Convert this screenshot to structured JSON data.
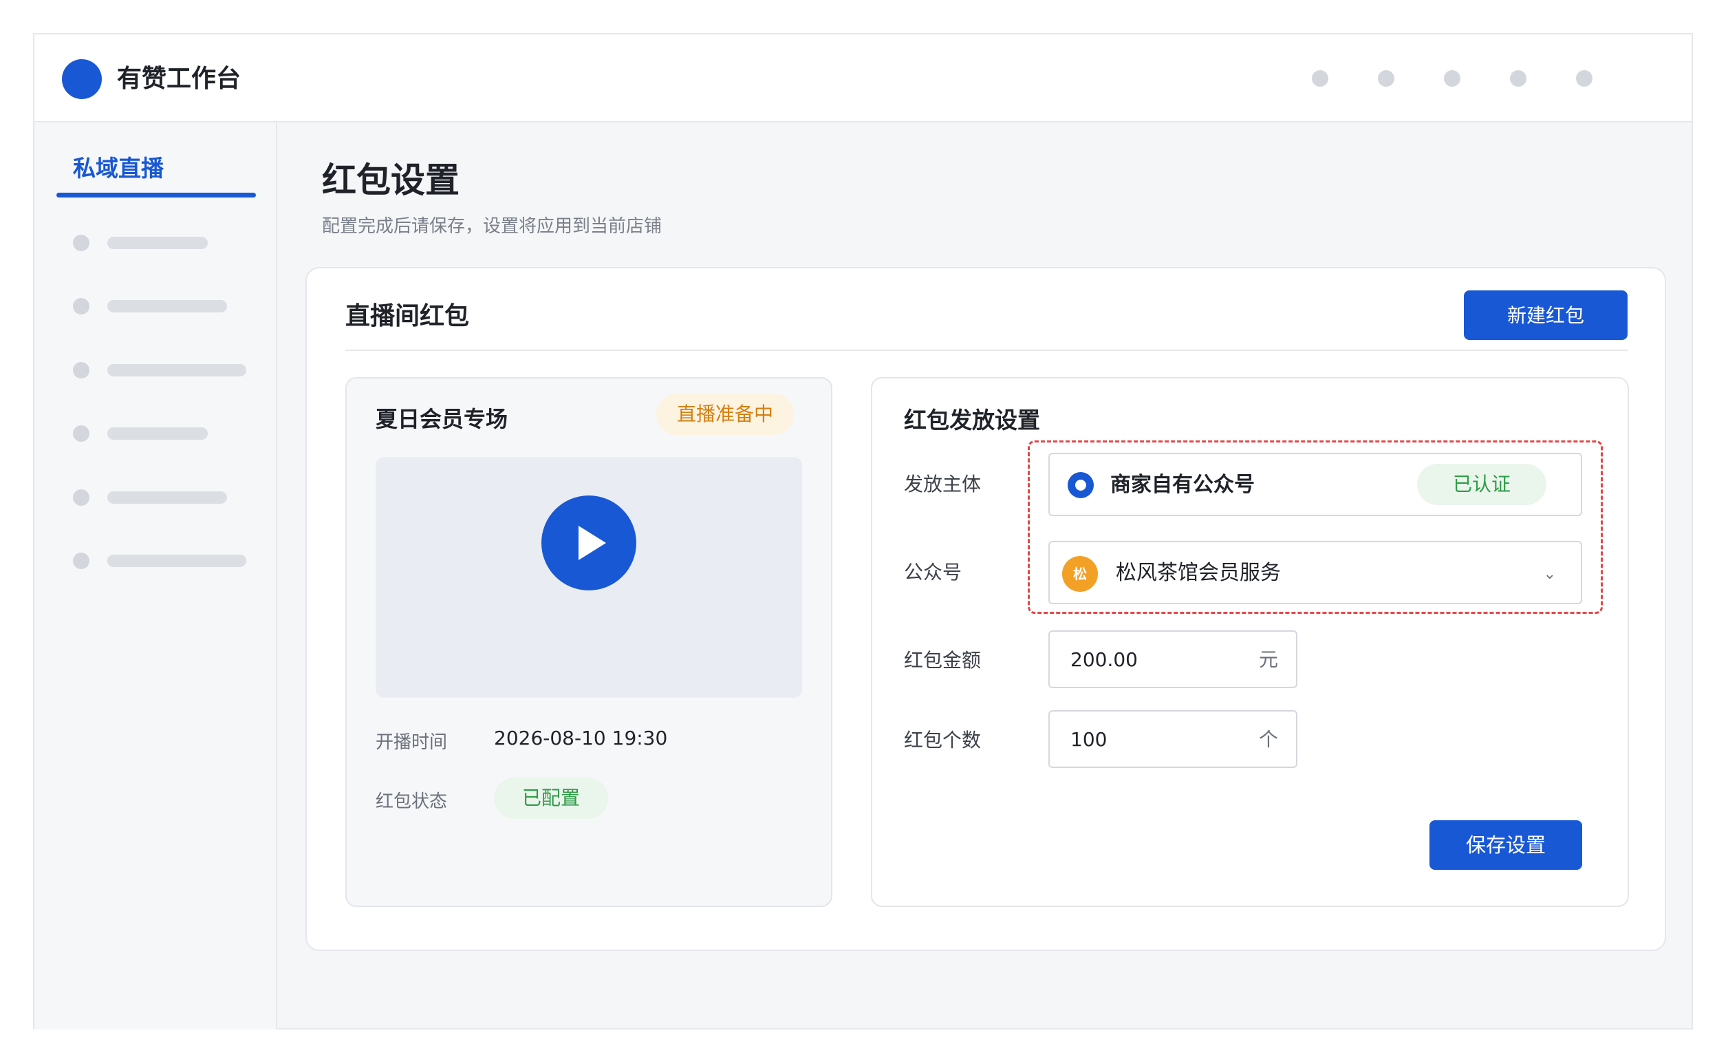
{
  "header": {
    "app_title": "有赞工作台",
    "dots": 5
  },
  "sidebar": {
    "title": "私域直播",
    "placeholder_items": 6
  },
  "page": {
    "title": "红包设置",
    "subtitle": "配置完成后请保存，设置将应用到当前店铺"
  },
  "panel": {
    "title": "直播间红包",
    "new_button": "新建红包"
  },
  "live_card": {
    "title": "夏日会员专场",
    "badge": "直播准备中",
    "start_time_label": "开播时间",
    "start_time_value": "2026-08-10 19:30",
    "status_label": "红包状态",
    "status_value": "已配置"
  },
  "settings": {
    "title": "红包发放设置",
    "issuer_label": "发放主体",
    "issuer_value": "商家自有公众号",
    "issuer_badge": "已认证",
    "account_label": "公众号",
    "account_avatar": "松",
    "account_value": "松风茶馆会员服务",
    "amount_label": "红包金额",
    "amount_value": "200.00",
    "amount_unit": "元",
    "count_label": "红包个数",
    "count_value": "100",
    "count_unit": "个",
    "save_button": "保存设置"
  },
  "colors": {
    "primary": "#1858d4",
    "highlight_dashed": "#e34545",
    "success": "#2d9b47",
    "warning": "#d47f0f"
  }
}
